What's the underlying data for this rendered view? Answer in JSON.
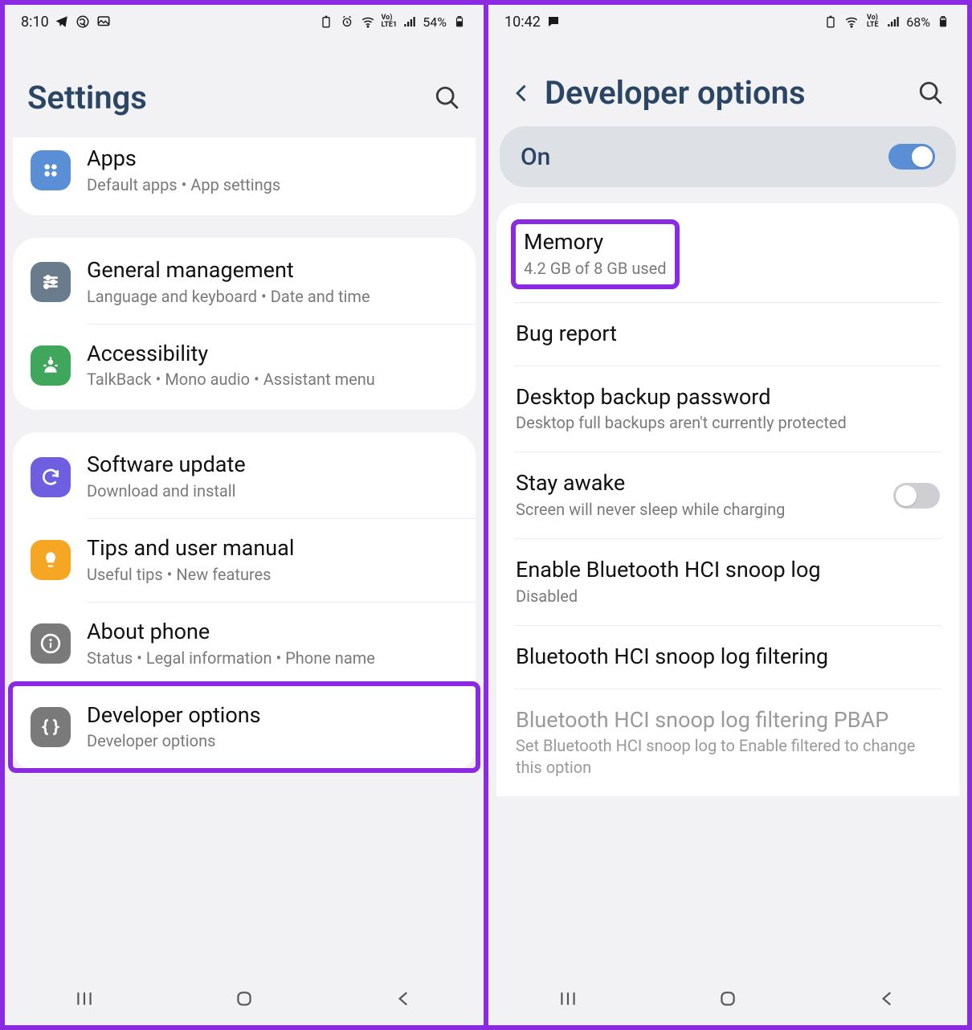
{
  "left": {
    "status": {
      "time": "8:10",
      "battery": "54%"
    },
    "header": {
      "title": "Settings"
    },
    "groups": [
      {
        "cutTop": true,
        "rows": [
          {
            "key": "apps",
            "icon": "grid-icon",
            "iconClass": "ic-blue",
            "title": "Apps",
            "sub": "Default apps  •  App settings"
          }
        ]
      },
      {
        "rows": [
          {
            "key": "general",
            "icon": "sliders-icon",
            "iconClass": "ic-slate",
            "title": "General management",
            "sub": "Language and keyboard  •  Date and time"
          },
          {
            "key": "accessibility",
            "icon": "person-icon",
            "iconClass": "ic-green",
            "title": "Accessibility",
            "sub": "TalkBack  •  Mono audio  •  Assistant menu"
          }
        ]
      },
      {
        "rows": [
          {
            "key": "software",
            "icon": "refresh-icon",
            "iconClass": "ic-purple",
            "title": "Software update",
            "sub": "Download and install"
          },
          {
            "key": "tips",
            "icon": "bulb-icon",
            "iconClass": "ic-orange",
            "title": "Tips and user manual",
            "sub": "Useful tips  •  New features"
          },
          {
            "key": "about",
            "icon": "info-icon",
            "iconClass": "ic-gray",
            "title": "About phone",
            "sub": "Status  •  Legal information  •  Phone name"
          },
          {
            "key": "developer",
            "icon": "braces-icon",
            "iconClass": "ic-gray",
            "title": "Developer options",
            "sub": "Developer options",
            "highlight": true
          }
        ]
      }
    ]
  },
  "right": {
    "status": {
      "time": "10:42",
      "battery": "68%"
    },
    "header": {
      "title": "Developer options"
    },
    "onbar": {
      "label": "On",
      "on": true
    },
    "rows": [
      {
        "key": "memory",
        "title": "Memory",
        "sub": "4.2 GB of 8 GB used",
        "highlight": true
      },
      {
        "key": "bugreport",
        "title": "Bug report"
      },
      {
        "key": "desktopbackup",
        "title": "Desktop backup password",
        "sub": "Desktop full backups aren't currently protected"
      },
      {
        "key": "stayawake",
        "title": "Stay awake",
        "sub": "Screen will never sleep while charging",
        "toggle": true,
        "toggleOn": false
      },
      {
        "key": "hcilog",
        "title": "Enable Bluetooth HCI snoop log",
        "sub": "Disabled"
      },
      {
        "key": "hcifilter",
        "title": "Bluetooth HCI snoop log filtering"
      },
      {
        "key": "hcipbap",
        "title": "Bluetooth HCI snoop log filtering PBAP",
        "sub": "Set Bluetooth HCI snoop log to Enable filtered to change this option",
        "dim": true
      }
    ]
  }
}
